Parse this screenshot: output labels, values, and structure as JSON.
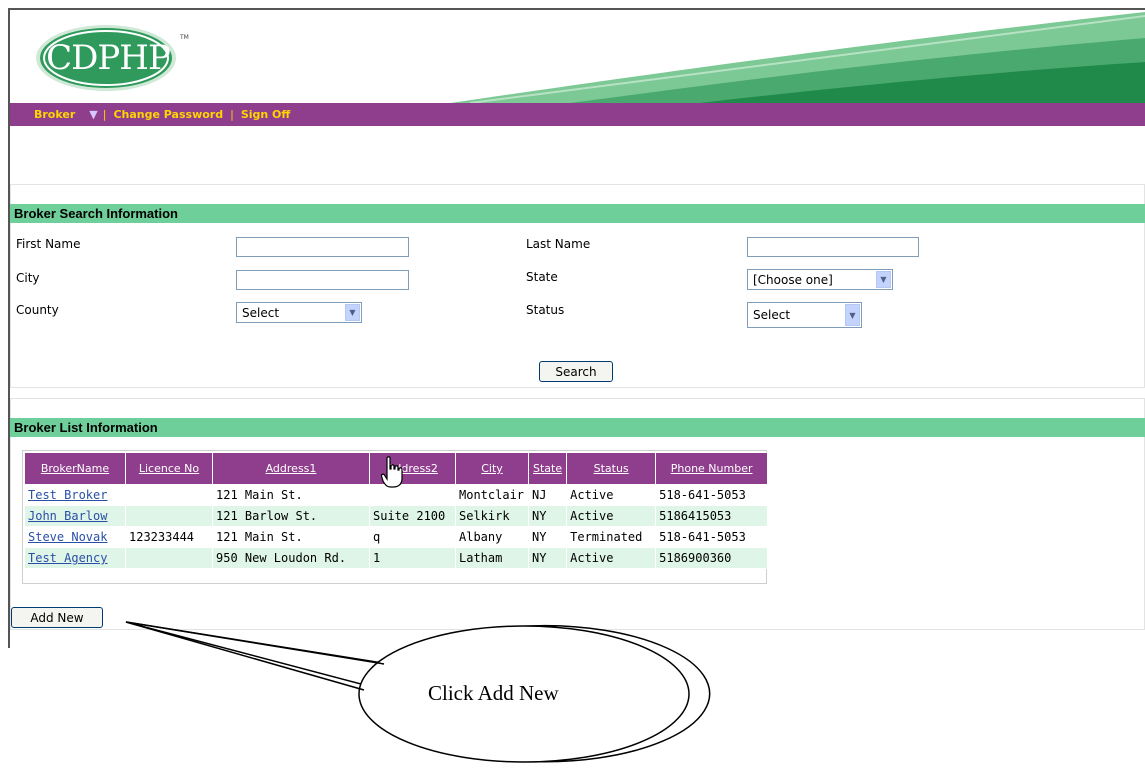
{
  "logo": {
    "text": "CDPHP",
    "tm": "TM"
  },
  "nav": {
    "broker": "Broker",
    "separator": "|",
    "change_password": "Change Password",
    "sign_off": "Sign Off"
  },
  "search_section": {
    "title": "Broker Search Information",
    "first_name_label": "First Name",
    "last_name_label": "Last Name",
    "city_label": "City",
    "state_label": "State",
    "county_label": "County",
    "status_label": "Status",
    "first_name_value": "",
    "last_name_value": "",
    "city_value": "",
    "state_value": "[Choose one]",
    "county_value": "Select",
    "status_value": "Select",
    "search_button": "Search"
  },
  "list_section": {
    "title": "Broker List Information",
    "columns": [
      "BrokerName",
      "Licence No",
      "Address1",
      "Address2",
      "City",
      "State",
      "Status",
      "Phone Number"
    ],
    "rows": [
      [
        "Test Broker",
        "",
        "121 Main St.",
        "",
        "Montclair",
        "NJ",
        "Active",
        "518-641-5053"
      ],
      [
        "John Barlow",
        "",
        "121 Barlow St.",
        "Suite 2100",
        "Selkirk",
        "NY",
        "Active",
        "5186415053"
      ],
      [
        "Steve Novak",
        "123233444",
        "121 Main St.",
        "q",
        "Albany",
        "NY",
        "Terminated",
        "518-641-5053"
      ],
      [
        "Test Agency",
        "",
        "950 New Loudon Rd.",
        "1",
        "Latham",
        "NY",
        "Active",
        "5186900360"
      ]
    ],
    "add_new_button": "Add New"
  },
  "callout": {
    "text": "Click Add New"
  },
  "colors": {
    "nav_bg": "#8e3e8c",
    "nav_text": "#ffd400",
    "section_bar": "#6fcf9a",
    "row_alt": "#dff5e8",
    "logo_green": "#2f9a5c"
  },
  "icons": {
    "dropdown": "chevron-down-icon",
    "cursor": "hand-pointer-icon"
  }
}
